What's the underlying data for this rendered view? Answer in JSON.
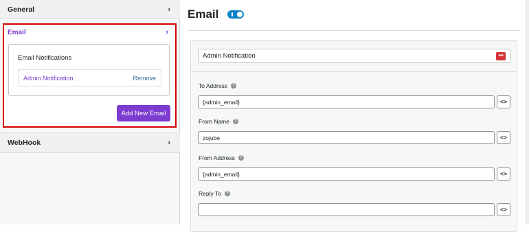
{
  "sidebar": {
    "general_label": "General",
    "email_label": "Email",
    "webhook_label": "WebHook",
    "chevron_glyph": "›",
    "email_notifications_title": "Email Notifications",
    "notifications": [
      {
        "name": "Admin Notification",
        "remove_label": "Remove"
      }
    ],
    "add_email_label": "Add New Email"
  },
  "main": {
    "title": "Email",
    "enabled": true,
    "card": {
      "title": "Admin Notification",
      "more_glyph": "•••",
      "fields": [
        {
          "label": "To Address",
          "value": "{admin_email}",
          "placeholder": ""
        },
        {
          "label": "From Name",
          "value": "zojube",
          "placeholder": ""
        },
        {
          "label": "From Address",
          "value": "{admin_email}",
          "placeholder": ""
        },
        {
          "label": "Reply To",
          "value": "",
          "placeholder": ""
        }
      ],
      "code_glyph": "<>",
      "help_glyph": "?"
    }
  },
  "colors": {
    "accent": "#7e3bd0",
    "toggle": "#0a84c6",
    "highlight_border": "#d40000",
    "danger": "#d63638"
  }
}
